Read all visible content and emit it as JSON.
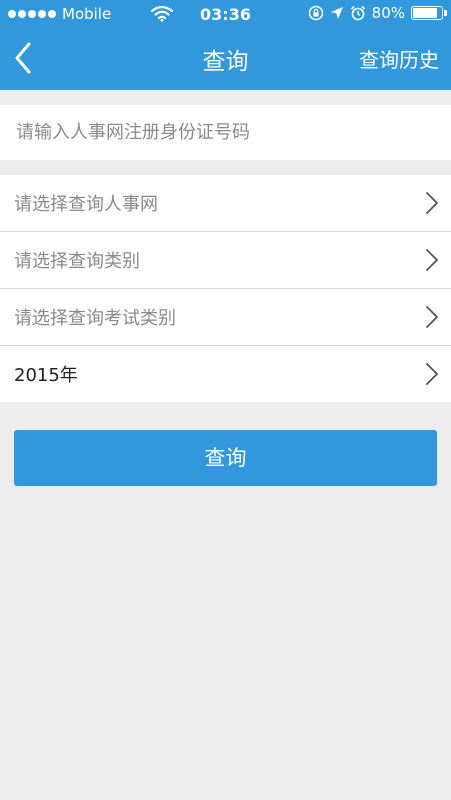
{
  "status_bar": {
    "carrier": "Mobile",
    "time": "03:36",
    "battery": "80%",
    "battery_level": 0.8,
    "icons": [
      "signal-dots",
      "wifi-icon",
      "rotation-lock-icon",
      "location-icon",
      "alarm-icon",
      "battery-icon"
    ]
  },
  "nav": {
    "title": "查询",
    "history_label": "查询历史",
    "back_icon": "chevron-left-icon"
  },
  "form": {
    "id_placeholder": "请输入人事网注册身份证号码",
    "id_value": "",
    "selects": [
      {
        "label": "请选择查询人事网",
        "placeholder": true
      },
      {
        "label": "请选择查询类别",
        "placeholder": true
      },
      {
        "label": "请选择查询考试类别",
        "placeholder": true
      },
      {
        "label": "2015年",
        "placeholder": false
      }
    ],
    "submit_label": "查询"
  },
  "colors": {
    "accent": "#3199db",
    "background": "#ececec",
    "placeholder_text": "#8a8a8a"
  }
}
